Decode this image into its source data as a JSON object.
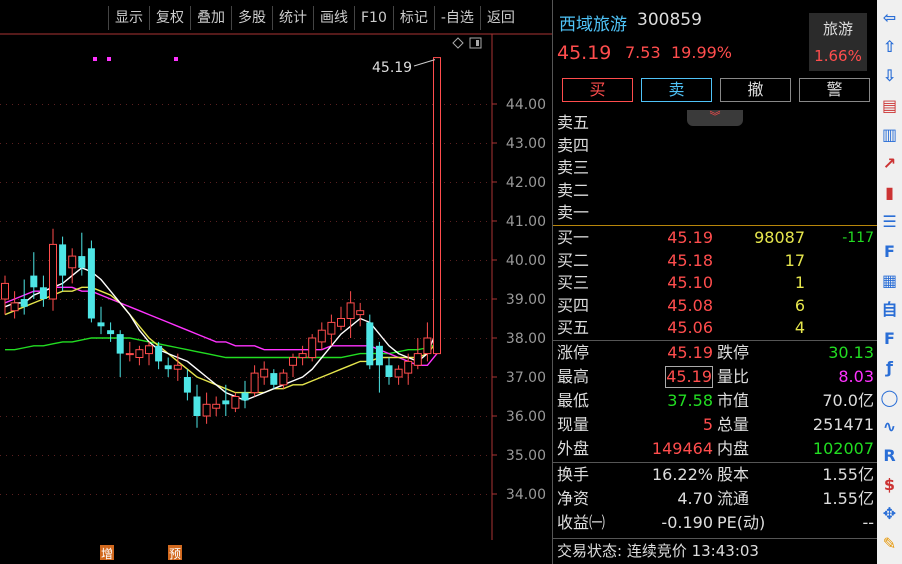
{
  "toolbar": {
    "items": [
      "显示",
      "复权",
      "叠加",
      "多股",
      "统计",
      "画线",
      "F10",
      "标记",
      "-自选",
      "返回"
    ]
  },
  "chart_data": {
    "type": "candlestick",
    "y_ticks": [
      "44.00",
      "43.00",
      "42.00",
      "41.00",
      "40.00",
      "39.00",
      "38.00",
      "37.00",
      "36.00",
      "35.00",
      "34.00"
    ],
    "ylim": [
      33.5,
      45.6
    ],
    "annotation": "45.19",
    "markers": [
      "增",
      "预"
    ],
    "candles": [
      {
        "o": 39.0,
        "h": 39.6,
        "l": 38.6,
        "c": 39.4
      },
      {
        "o": 38.7,
        "h": 39.2,
        "l": 38.5,
        "c": 38.9
      },
      {
        "o": 39.0,
        "h": 39.5,
        "l": 38.6,
        "c": 38.8
      },
      {
        "o": 39.6,
        "h": 40.2,
        "l": 39.0,
        "c": 39.3
      },
      {
        "o": 39.3,
        "h": 39.6,
        "l": 38.8,
        "c": 39.0
      },
      {
        "o": 39.0,
        "h": 40.8,
        "l": 38.7,
        "c": 40.4
      },
      {
        "o": 40.4,
        "h": 40.6,
        "l": 39.2,
        "c": 39.6
      },
      {
        "o": 39.8,
        "h": 40.3,
        "l": 39.4,
        "c": 40.1
      },
      {
        "o": 40.1,
        "h": 40.7,
        "l": 39.6,
        "c": 39.8
      },
      {
        "o": 40.3,
        "h": 40.5,
        "l": 38.4,
        "c": 38.5
      },
      {
        "o": 38.4,
        "h": 38.8,
        "l": 38.1,
        "c": 38.3
      },
      {
        "o": 38.2,
        "h": 38.4,
        "l": 37.9,
        "c": 38.1
      },
      {
        "o": 38.1,
        "h": 38.2,
        "l": 37.0,
        "c": 37.6
      },
      {
        "o": 37.6,
        "h": 37.9,
        "l": 37.4,
        "c": 37.6
      },
      {
        "o": 37.5,
        "h": 37.8,
        "l": 37.3,
        "c": 37.7
      },
      {
        "o": 37.6,
        "h": 37.9,
        "l": 37.3,
        "c": 37.8
      },
      {
        "o": 37.8,
        "h": 37.9,
        "l": 37.2,
        "c": 37.4
      },
      {
        "o": 37.3,
        "h": 37.5,
        "l": 37.0,
        "c": 37.2
      },
      {
        "o": 37.2,
        "h": 37.6,
        "l": 36.9,
        "c": 37.3
      },
      {
        "o": 37.0,
        "h": 37.2,
        "l": 36.4,
        "c": 36.6
      },
      {
        "o": 36.5,
        "h": 36.8,
        "l": 35.7,
        "c": 36.0
      },
      {
        "o": 36.0,
        "h": 36.6,
        "l": 35.8,
        "c": 36.3
      },
      {
        "o": 36.2,
        "h": 36.5,
        "l": 36.0,
        "c": 36.3
      },
      {
        "o": 36.4,
        "h": 36.8,
        "l": 36.0,
        "c": 36.3
      },
      {
        "o": 36.2,
        "h": 36.6,
        "l": 36.1,
        "c": 36.5
      },
      {
        "o": 36.6,
        "h": 36.9,
        "l": 36.2,
        "c": 36.4
      },
      {
        "o": 36.6,
        "h": 37.3,
        "l": 36.5,
        "c": 37.1
      },
      {
        "o": 37.0,
        "h": 37.4,
        "l": 36.8,
        "c": 37.2
      },
      {
        "o": 37.1,
        "h": 37.2,
        "l": 36.7,
        "c": 36.8
      },
      {
        "o": 36.8,
        "h": 37.2,
        "l": 36.7,
        "c": 37.1
      },
      {
        "o": 37.3,
        "h": 37.6,
        "l": 37.0,
        "c": 37.5
      },
      {
        "o": 37.5,
        "h": 37.8,
        "l": 37.3,
        "c": 37.6
      },
      {
        "o": 37.5,
        "h": 38.1,
        "l": 37.4,
        "c": 38.0
      },
      {
        "o": 37.9,
        "h": 38.4,
        "l": 37.7,
        "c": 38.2
      },
      {
        "o": 38.1,
        "h": 38.6,
        "l": 37.8,
        "c": 38.4
      },
      {
        "o": 38.3,
        "h": 38.8,
        "l": 38.2,
        "c": 38.5
      },
      {
        "o": 38.5,
        "h": 39.2,
        "l": 38.0,
        "c": 38.9
      },
      {
        "o": 38.6,
        "h": 38.9,
        "l": 38.3,
        "c": 38.7
      },
      {
        "o": 38.4,
        "h": 38.6,
        "l": 37.2,
        "c": 37.3
      },
      {
        "o": 37.8,
        "h": 37.9,
        "l": 36.6,
        "c": 37.3
      },
      {
        "o": 37.3,
        "h": 37.5,
        "l": 36.8,
        "c": 37.0
      },
      {
        "o": 37.0,
        "h": 37.3,
        "l": 36.8,
        "c": 37.2
      },
      {
        "o": 37.1,
        "h": 37.6,
        "l": 36.8,
        "c": 37.4
      },
      {
        "o": 37.3,
        "h": 38.0,
        "l": 37.2,
        "c": 37.6
      },
      {
        "o": 37.6,
        "h": 38.4,
        "l": 37.4,
        "c": 38.0
      },
      {
        "o": 37.6,
        "h": 45.19,
        "l": 37.6,
        "c": 45.19
      }
    ],
    "ma_white": [
      38.8,
      38.9,
      38.9,
      39.1,
      39.2,
      39.3,
      39.4,
      39.6,
      39.8,
      39.7,
      39.5,
      39.2,
      38.9,
      38.6,
      38.2,
      37.9,
      37.7,
      37.6,
      37.5,
      37.4,
      37.2,
      37.0,
      36.8,
      36.6,
      36.5,
      36.4,
      36.5,
      36.6,
      36.7,
      36.8,
      36.9,
      37.0,
      37.2,
      37.5,
      37.8,
      38.1,
      38.3,
      38.5,
      38.4,
      38.1,
      37.8,
      37.6,
      37.5,
      37.4,
      37.6,
      38.2
    ],
    "ma_yellow": [
      38.6,
      38.7,
      38.8,
      38.9,
      39.0,
      39.1,
      39.2,
      39.2,
      39.3,
      39.3,
      39.2,
      39.1,
      38.9,
      38.6,
      38.3,
      38.0,
      37.8,
      37.6,
      37.4,
      37.2,
      37.0,
      36.9,
      36.8,
      36.7,
      36.6,
      36.6,
      36.6,
      36.6,
      36.7,
      36.7,
      36.8,
      36.8,
      36.9,
      37.0,
      37.1,
      37.2,
      37.3,
      37.4,
      37.4,
      37.5,
      37.5,
      37.5,
      37.5,
      37.5,
      37.6,
      37.9
    ],
    "ma_magenta": [
      38.9,
      39.0,
      39.1,
      39.2,
      39.2,
      39.3,
      39.3,
      39.3,
      39.2,
      39.2,
      39.1,
      39.0,
      38.9,
      38.8,
      38.7,
      38.6,
      38.5,
      38.4,
      38.3,
      38.2,
      38.1,
      38.0,
      37.9,
      37.9,
      37.8,
      37.8,
      37.8,
      37.7,
      37.7,
      37.7,
      37.7,
      37.7,
      37.7,
      37.7,
      37.8,
      37.8,
      37.8,
      37.8,
      37.8,
      37.7,
      37.6,
      37.5,
      37.4,
      37.3,
      37.3,
      37.6
    ],
    "ma_green": [
      37.7,
      37.7,
      37.75,
      37.8,
      37.8,
      37.85,
      37.9,
      37.9,
      37.95,
      38.0,
      38.0,
      38.0,
      38.0,
      38.0,
      37.95,
      37.9,
      37.85,
      37.8,
      37.75,
      37.7,
      37.65,
      37.6,
      37.55,
      37.5,
      37.5,
      37.5,
      37.5,
      37.5,
      37.5,
      37.5,
      37.5,
      37.5,
      37.5,
      37.5,
      37.5,
      37.5,
      37.55,
      37.6,
      37.6,
      37.6,
      37.6,
      37.65,
      37.7,
      37.7,
      37.75,
      37.85
    ]
  },
  "quote": {
    "name": "西域旅游",
    "code": "300859",
    "price": "45.19",
    "change": "7.53",
    "pct": "19.99%",
    "sector_name": "旅游",
    "sector_pct": "1.66%"
  },
  "buttons": {
    "buy": "买",
    "sell": "卖",
    "cancel": "撤",
    "alert": "警"
  },
  "asks": [
    {
      "label": "卖五"
    },
    {
      "label": "卖四"
    },
    {
      "label": "卖三"
    },
    {
      "label": "卖二"
    },
    {
      "label": "卖一"
    }
  ],
  "bids": [
    {
      "label": "买一",
      "price": "45.19",
      "vol": "98087",
      "delta": "-117"
    },
    {
      "label": "买二",
      "price": "45.18",
      "vol": "17",
      "delta": ""
    },
    {
      "label": "买三",
      "price": "45.10",
      "vol": "1",
      "delta": ""
    },
    {
      "label": "买四",
      "price": "45.08",
      "vol": "6",
      "delta": ""
    },
    {
      "label": "买五",
      "price": "45.06",
      "vol": "4",
      "delta": ""
    }
  ],
  "stats": [
    {
      "l1": "涨停",
      "v1": "45.19",
      "l2": "跌停",
      "v2": "30.13"
    },
    {
      "l1": "最高",
      "v1": "45.19",
      "l2": "量比",
      "v2": "8.03"
    },
    {
      "l1": "最低",
      "v1": "37.58",
      "l2": "市值",
      "v2": "70.0亿"
    },
    {
      "l1": "现量",
      "v1": "5",
      "l2": "总量",
      "v2": "251471"
    },
    {
      "l1": "外盘",
      "v1": "149464",
      "l2": "内盘",
      "v2": "102007"
    }
  ],
  "fundamentals": [
    {
      "l1": "换手",
      "v1": "16.22%",
      "l2": "股本",
      "v2": "1.55亿"
    },
    {
      "l1": "净资",
      "v1": "4.70",
      "l2": "流通",
      "v2": "1.55亿"
    },
    {
      "l1": "收益㈠",
      "v1": "-0.190",
      "l2": "PE(动)",
      "v2": "--"
    }
  ],
  "status": "交易状态: 连续竞价 13:43:03",
  "colors": {
    "up": "#ff4d4d",
    "down": "#4ee6e6",
    "accent": "#4fc3f7",
    "green": "#22dd22",
    "magenta": "#ff33ff",
    "yellow": "#e6e64d"
  },
  "sidebar_icons": [
    "arrow-left-icon",
    "arrow-up-icon",
    "arrow-down-icon",
    "book-icon",
    "bar-chart-icon",
    "line-chart-icon",
    "candlestick-icon",
    "list-icon",
    "f10-icon",
    "layers-icon",
    "self-select-icon",
    "f12-icon",
    "function-icon",
    "circle-icon",
    "wave-icon",
    "rsi-icon",
    "dollar-icon",
    "move-icon",
    "pencil-icon"
  ]
}
